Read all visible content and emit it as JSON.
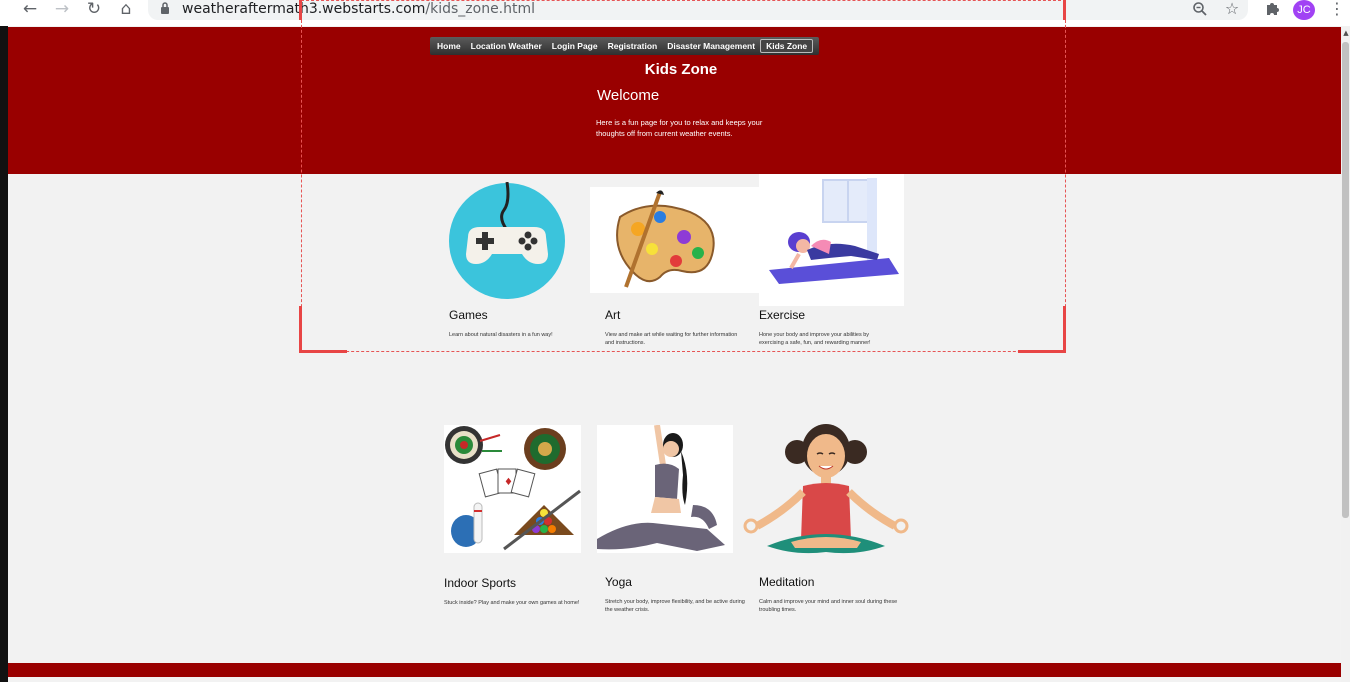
{
  "browser": {
    "url_host": "weatheraftermath3.webstarts.com",
    "url_path": "/kids_zone.html",
    "profile_initials": "JC",
    "icons": [
      "back-icon",
      "forward-icon",
      "reload-icon",
      "home-icon",
      "lock-icon",
      "zoom-icon",
      "bookmark-star-icon",
      "extensions-icon",
      "menu-dots-icon"
    ]
  },
  "nav": {
    "items": [
      {
        "label": "Home"
      },
      {
        "label": "Location Weather"
      },
      {
        "label": "Login Page"
      },
      {
        "label": "Registration"
      },
      {
        "label": "Disaster Management"
      },
      {
        "label": "Kids Zone"
      }
    ],
    "active": "Kids Zone"
  },
  "header": {
    "title": "Kids Zone",
    "welcome": "Welcome",
    "intro": "Here is a fun page for you to relax and keeps your thoughts off from current weather events."
  },
  "cards": [
    {
      "title": "Games",
      "desc": "Learn about natural disasters in a fun way!"
    },
    {
      "title": "Art",
      "desc": "View and make art while waiting for further information and instructions."
    },
    {
      "title": "Exercise",
      "desc": "Hone your body and improve your abilities by exercising a safe, fun, and rewarding manner!"
    },
    {
      "title": "Indoor Sports",
      "desc": "Stuck inside? Play and make your own games at home!"
    },
    {
      "title": "Yoga",
      "desc": "Stretch your body, improve flexibility, and be active during the weather crisis."
    },
    {
      "title": "Meditation",
      "desc": "Calm and improve your mind and inner soul during these troubling times."
    }
  ],
  "colors": {
    "header_bg": "#990000",
    "page_bg": "#f2f2f2",
    "selection": "#e84545"
  }
}
